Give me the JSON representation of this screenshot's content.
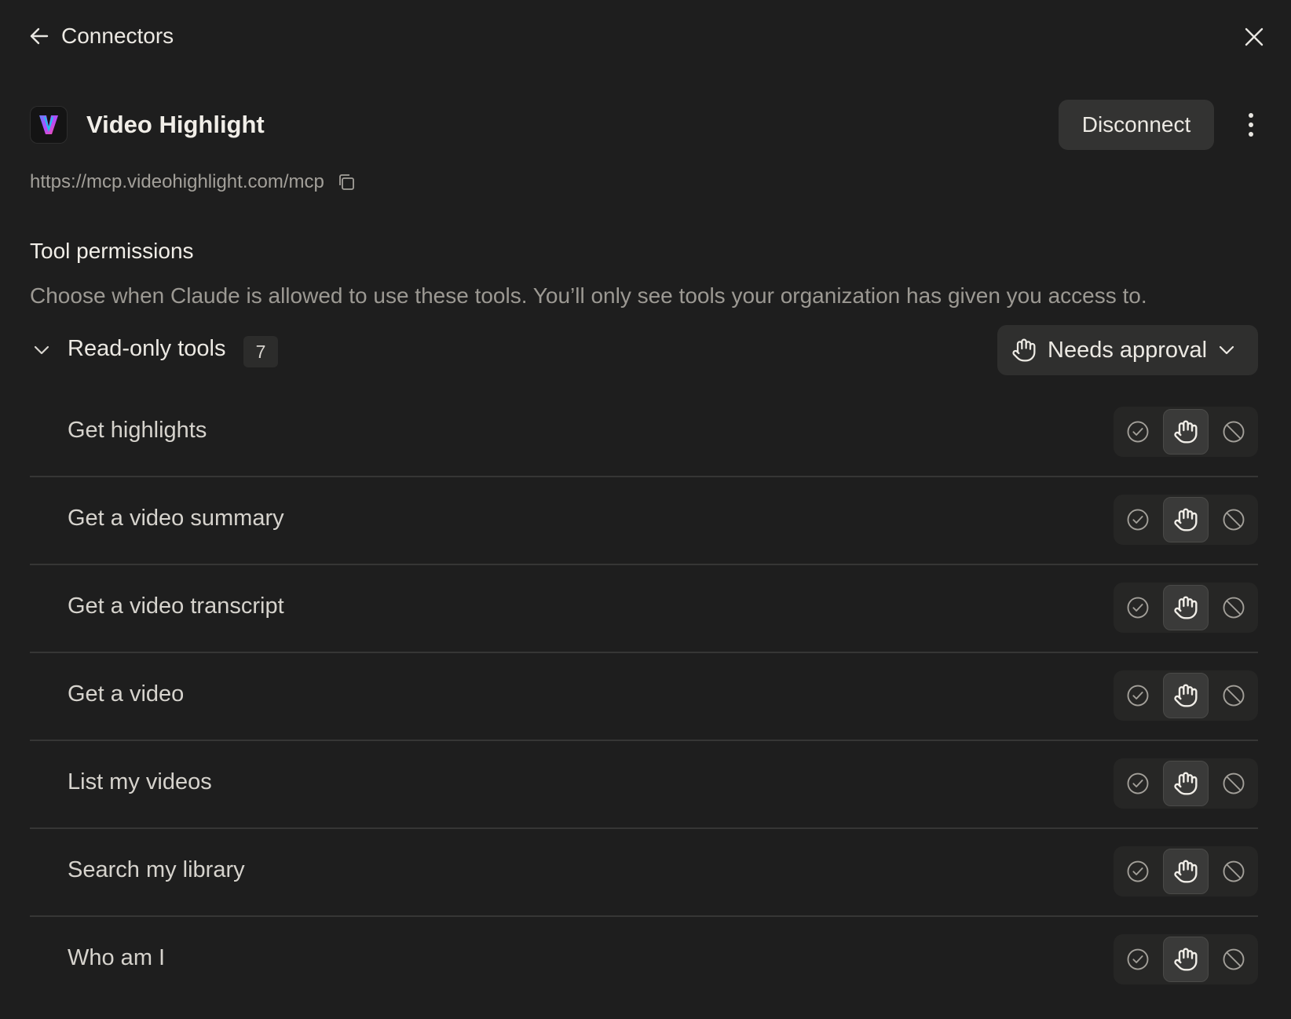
{
  "header": {
    "title": "Connectors"
  },
  "connector": {
    "name": "Video Highlight",
    "url": "https://mcp.videohighlight.com/mcp",
    "disconnect_label": "Disconnect"
  },
  "permissions": {
    "title": "Tool permissions",
    "description": "Choose when Claude is allowed to use these tools. You’ll only see tools your organization has given you access to."
  },
  "group": {
    "label": "Read-only tools",
    "count": "7",
    "selected_policy": "Needs approval"
  },
  "tools": [
    {
      "label": "Get highlights",
      "selected": "needs-approval"
    },
    {
      "label": "Get a video summary",
      "selected": "needs-approval"
    },
    {
      "label": "Get a video transcript",
      "selected": "needs-approval"
    },
    {
      "label": "Get a video",
      "selected": "needs-approval"
    },
    {
      "label": "List my videos",
      "selected": "needs-approval"
    },
    {
      "label": "Search my library",
      "selected": "needs-approval"
    },
    {
      "label": "Who am I",
      "selected": "needs-approval"
    }
  ],
  "icons": {
    "back": "arrow-left-icon",
    "close": "close-icon",
    "more": "more-vertical-icon",
    "copy": "copy-icon",
    "chevron": "chevron-down-icon",
    "hand": "hand-icon",
    "allow": "check-circle-icon",
    "block": "block-icon"
  },
  "colors": {
    "background": "#1e1e1e",
    "text": "#e8e6e1",
    "muted": "#9c9993",
    "button": "#333332",
    "divider": "#363635"
  }
}
